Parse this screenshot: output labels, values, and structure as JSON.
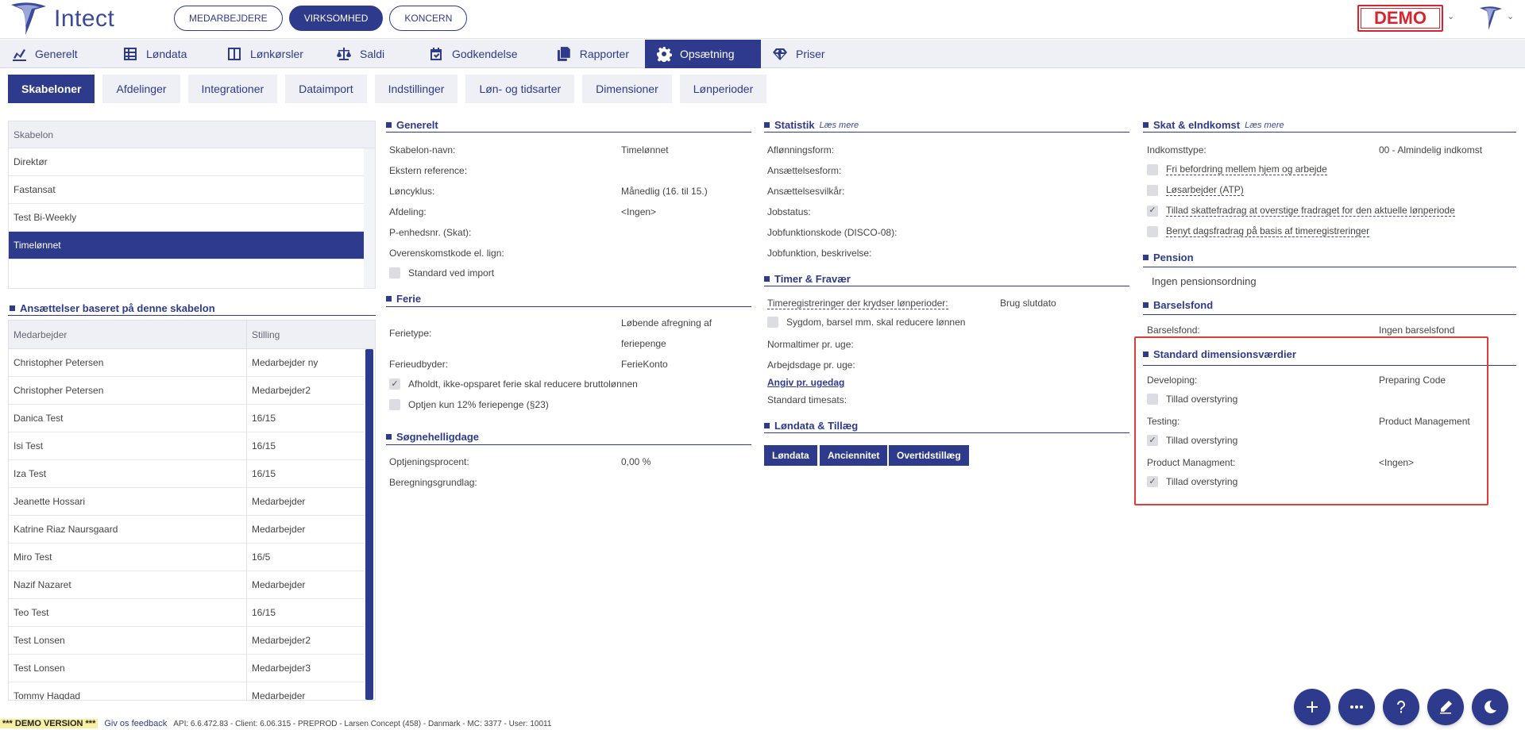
{
  "header": {
    "logo_text": "Intect",
    "tabs": [
      {
        "label": "MEDARBEJDERE",
        "active": false
      },
      {
        "label": "VIRKSOMHED",
        "active": true
      },
      {
        "label": "KONCERN",
        "active": false
      }
    ],
    "demo_label": "DEMO"
  },
  "nav": [
    {
      "label": "Generelt",
      "icon": "chart-icon"
    },
    {
      "label": "Løndata",
      "icon": "table-icon"
    },
    {
      "label": "Lønkørsler",
      "icon": "columns-icon"
    },
    {
      "label": "Saldi",
      "icon": "scale-icon"
    },
    {
      "label": "Godkendelse",
      "icon": "calendar-check-icon"
    },
    {
      "label": "Rapporter",
      "icon": "copy-icon"
    },
    {
      "label": "Opsætning",
      "icon": "gear-icon"
    },
    {
      "label": "Priser",
      "icon": "diamond-icon"
    }
  ],
  "subtabs": [
    "Skabeloner",
    "Afdelinger",
    "Integrationer",
    "Dataimport",
    "Indstillinger",
    "Løn- og tidsarter",
    "Dimensioner",
    "Lønperioder"
  ],
  "templates": {
    "header": "Skabelon",
    "items": [
      "Direktør",
      "Fastansat",
      "Test Bi-Weekly",
      "Timelønnet"
    ],
    "selected": "Timelønnet"
  },
  "employments": {
    "title": "Ansættelser baseret på denne skabelon",
    "col_employee": "Medarbejder",
    "col_position": "Stilling",
    "rows": [
      [
        "Christopher Petersen",
        "Medarbejder ny"
      ],
      [
        "Christopher Petersen",
        "Medarbejder2"
      ],
      [
        "Danica Test",
        "16/15"
      ],
      [
        "Isi Test",
        "16/15"
      ],
      [
        "Iza Test",
        "16/15"
      ],
      [
        "Jeanette Hossari",
        "Medarbejder"
      ],
      [
        "Katrine Riaz Naursgaard",
        "Medarbejder"
      ],
      [
        "Miro Test",
        "16/5"
      ],
      [
        "Nazif Nazaret",
        "Medarbejder"
      ],
      [
        "Teo Test",
        "16/15"
      ],
      [
        "Test Lonsen",
        "Medarbejder2"
      ],
      [
        "Test Lonsen",
        "Medarbejder3"
      ],
      [
        "Tommy Haqdad",
        "Medarbejder"
      ]
    ]
  },
  "generelt": {
    "title": "Generelt",
    "name_label": "Skabelon-navn:",
    "name_value": "Timelønnet",
    "extref_label": "Ekstern reference:",
    "cycle_label": "Løncyklus:",
    "cycle_value": "Månedlig (16. til 15.)",
    "dept_label": "Afdeling:",
    "dept_value": "<Ingen>",
    "punit_label": "P-enhedsnr. (Skat):",
    "agreement_label": "Overenskomstkode el. lign:",
    "std_import": "Standard ved import"
  },
  "ferie": {
    "title": "Ferie",
    "type_label": "Ferietype:",
    "type_value_1": "Løbende afregning af",
    "type_value_2": "feriepenge",
    "provider_label": "Ferieudbyder:",
    "provider_value": "FerieKonto",
    "reduce_label": "Afholdt, ikke-opsparet ferie skal reducere bruttolønnen",
    "only12_label": "Optjen kun 12% feriepenge (§23)"
  },
  "sogn": {
    "title": "Søgnehelligdage",
    "pct_label": "Optjeningsprocent:",
    "pct_value": "0,00 %",
    "basis_label": "Beregningsgrundlag:"
  },
  "statistik": {
    "title": "Statistik",
    "more": "Læs mere",
    "f1": "Aflønningsform:",
    "f2": "Ansættelsesform:",
    "f3": "Ansættelsesvilkår:",
    "f4": "Jobstatus:",
    "f5": "Jobfunktionskode (DISCO-08):",
    "f6": "Jobfunktion, beskrivelse:"
  },
  "timer": {
    "title": "Timer & Fravær",
    "cross_label": "Timeregistreringer der krydser lønperioder:",
    "cross_value": "Brug slutdato",
    "sick_label": "Sygdom, barsel mm. skal reducere lønnen",
    "normal_label": "Normaltimer pr. uge:",
    "days_label": "Arbejdsdage pr. uge:",
    "weekday_link": "Angiv pr. ugedag",
    "rate_label": "Standard timesats:"
  },
  "londata": {
    "title": "Løndata & Tillæg",
    "buttons": [
      "Løndata",
      "Anciennitet",
      "Overtidstillæg"
    ]
  },
  "skat": {
    "title": "Skat & eIndkomst",
    "more": "Læs mere",
    "income_label": "Indkomsttype:",
    "income_value": "00 - Almindelig indkomst",
    "c1": "Fri befordring mellem hjem og arbejde",
    "c2": "Løsarbejder (ATP)",
    "c3": "Tillad skattefradrag at overstige fradraget for den aktuelle lønperiode",
    "c4": "Benyt dagsfradrag på basis af timeregistreringer"
  },
  "pension": {
    "title": "Pension",
    "value": "Ingen pensionsordning"
  },
  "barsel": {
    "title": "Barselsfond",
    "label": "Barselsfond:",
    "value": "Ingen barselsfond"
  },
  "dims": {
    "title": "Standard dimensionsværdier",
    "d1_label": "Developing:",
    "d1_value": "Preparing Code",
    "d2_label": "Testing:",
    "d2_value": "Product Management",
    "d3_label": "Product Managment:",
    "d3_value": "<Ingen>",
    "override": "Tillad overstyring"
  },
  "footer": {
    "demo": "*** DEMO VERSION ***",
    "feedback": "Giv os feedback",
    "info": "API: 6.6.472.83 - Client: 6.06.315 - PREPROD - Larsen Concept (458) - Danmark - MC: 3377 - User: 10011"
  },
  "colors": {
    "primary": "#2e3a8c",
    "demo_red": "#d9232e",
    "highlight": "#e23b3b"
  }
}
